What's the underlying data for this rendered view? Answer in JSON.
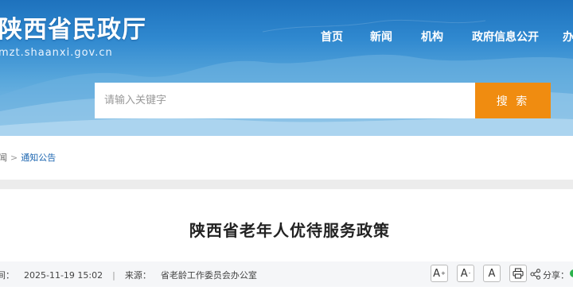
{
  "header": {
    "site_title": "陕西省民政厅",
    "site_url": "mzt.shaanxi.gov.cn"
  },
  "nav": {
    "items": [
      "首页",
      "新闻",
      "机构",
      "政府信息公开",
      "办"
    ]
  },
  "search": {
    "placeholder": "请输入关键字",
    "value": "",
    "button_label": "搜 索"
  },
  "breadcrumb": {
    "prev": "闻",
    "separator": ">",
    "current": "通知公告"
  },
  "article": {
    "title": "陕西省老年人优待服务政策",
    "date_label": "间：",
    "date": "2025-11-19 15:02",
    "divider": "|",
    "source_label": "来源：",
    "source": "省老龄工作委员会办公室",
    "font_large": "A",
    "font_large_mark": "+",
    "font_medium": "A",
    "font_medium_mark": "-",
    "font_default": "A",
    "share_label": "分享："
  },
  "colors": {
    "brand_blue": "#1e72bd",
    "search_button": "#f08c10",
    "link_blue": "#1b65b0",
    "wechat_green": "#2bb24c"
  },
  "icons": {
    "print": "print-icon",
    "share": "share-icon",
    "wechat": "wechat-icon"
  }
}
